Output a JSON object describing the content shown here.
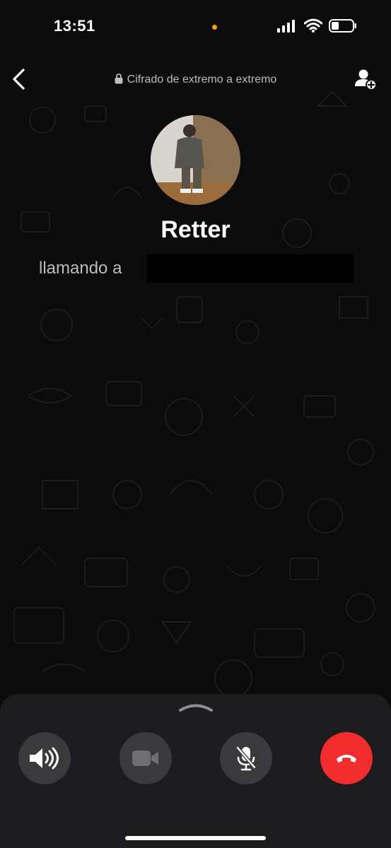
{
  "status_bar": {
    "time": "13:51",
    "indicator_color": "#ff9f0a"
  },
  "header": {
    "back_icon": "chevron-left-icon",
    "encryption_text": "Cifrado de extremo a extremo",
    "encryption_icon": "lock-icon",
    "add_participant_icon": "add-person-icon"
  },
  "contact": {
    "name": "Retter",
    "status_text": "llamando a"
  },
  "controls": {
    "handle_icon": "chevron-up-icon",
    "buttons": [
      {
        "name": "speaker",
        "icon": "speaker-icon"
      },
      {
        "name": "video",
        "icon": "video-camera-icon"
      },
      {
        "name": "mute",
        "icon": "microphone-off-icon"
      },
      {
        "name": "end-call",
        "icon": "phone-hangup-icon",
        "color": "#f22c2c"
      }
    ]
  }
}
